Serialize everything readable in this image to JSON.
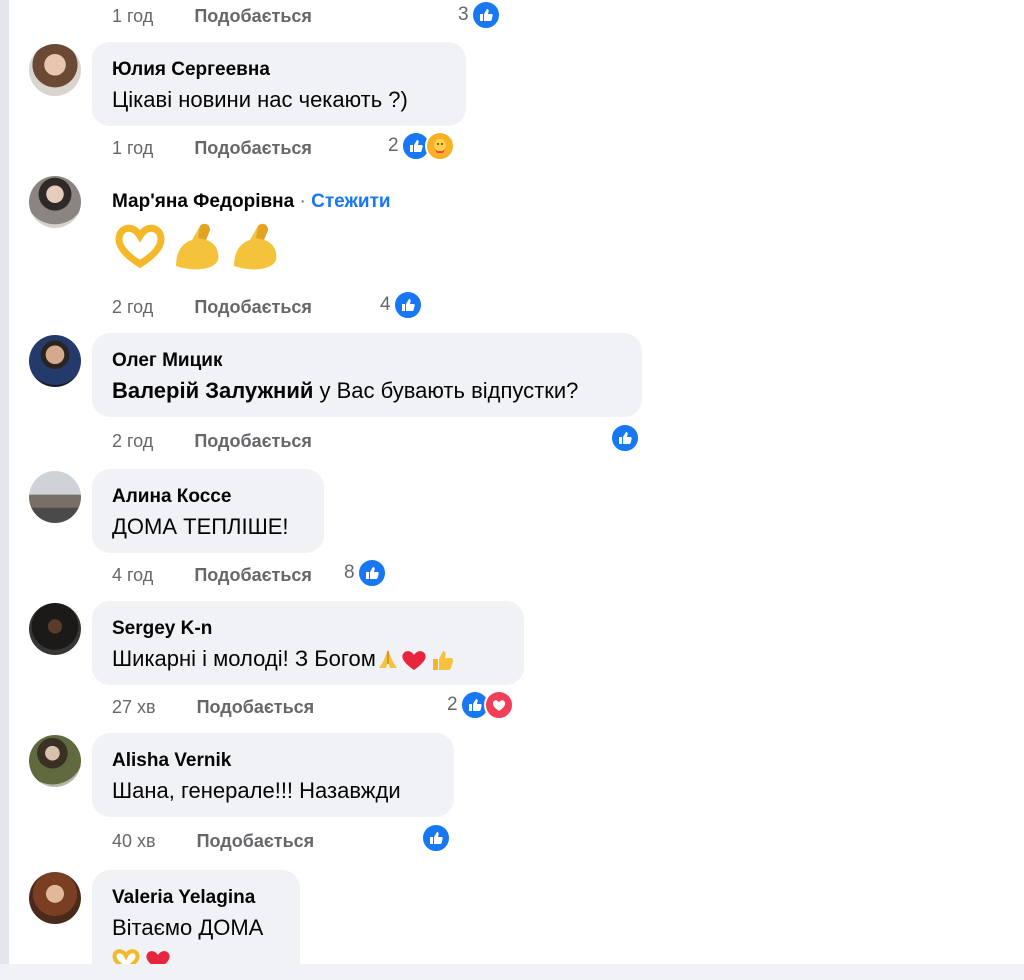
{
  "colors": {
    "accent": "#1877f2",
    "bubble": "#f0f2f5",
    "meta": "#65676b",
    "love": "#f33e58",
    "care": "#f7b125"
  },
  "like_label": "Подобається",
  "top": {
    "time": "1 год",
    "count": "3"
  },
  "comments": [
    {
      "author": "Юлия Сергеевна",
      "text": "Цікаві новини нас чекають ?)",
      "time": "1 год",
      "count": "2",
      "reactions": [
        "like-icon",
        "care-icon"
      ]
    },
    {
      "author": "Мар'яна Федорівна",
      "follow_sep": "·",
      "follow": "Стежити",
      "emojis": [
        "heart-hands-icon",
        "flexed-biceps-icon",
        "flexed-biceps-icon"
      ],
      "time": "2 год",
      "count": "4",
      "reactions": [
        "like-icon"
      ]
    },
    {
      "author": "Олег Мицик",
      "mention": "Валерій Залужний",
      "text": " у Вас бувають відпустки?",
      "time": "2 год",
      "count": "",
      "reactions": [
        "like-icon"
      ]
    },
    {
      "author": "Алина Коссе",
      "text": "ДОМА ТЕПЛІШЕ!",
      "time": "4 год",
      "count": "8",
      "reactions": [
        "like-icon"
      ]
    },
    {
      "author": "Sergey K-n",
      "text": "Шикарні і молоді! З Богом",
      "text_emojis": [
        "folded-hands-icon",
        "red-heart-icon",
        "thumbs-up-icon"
      ],
      "time": "27 хв",
      "count": "2",
      "reactions": [
        "like-icon",
        "love-icon"
      ]
    },
    {
      "author": "Alisha Vernik",
      "text": "Шана, генерале!!! Назавжди",
      "time": "40 хв",
      "count": "",
      "reactions": [
        "like-icon"
      ]
    },
    {
      "author": "Valeria Yelagina",
      "text": "Вітаємо ДОМА",
      "text_emojis": [
        "heart-hands-icon",
        "red-heart-icon"
      ]
    }
  ]
}
